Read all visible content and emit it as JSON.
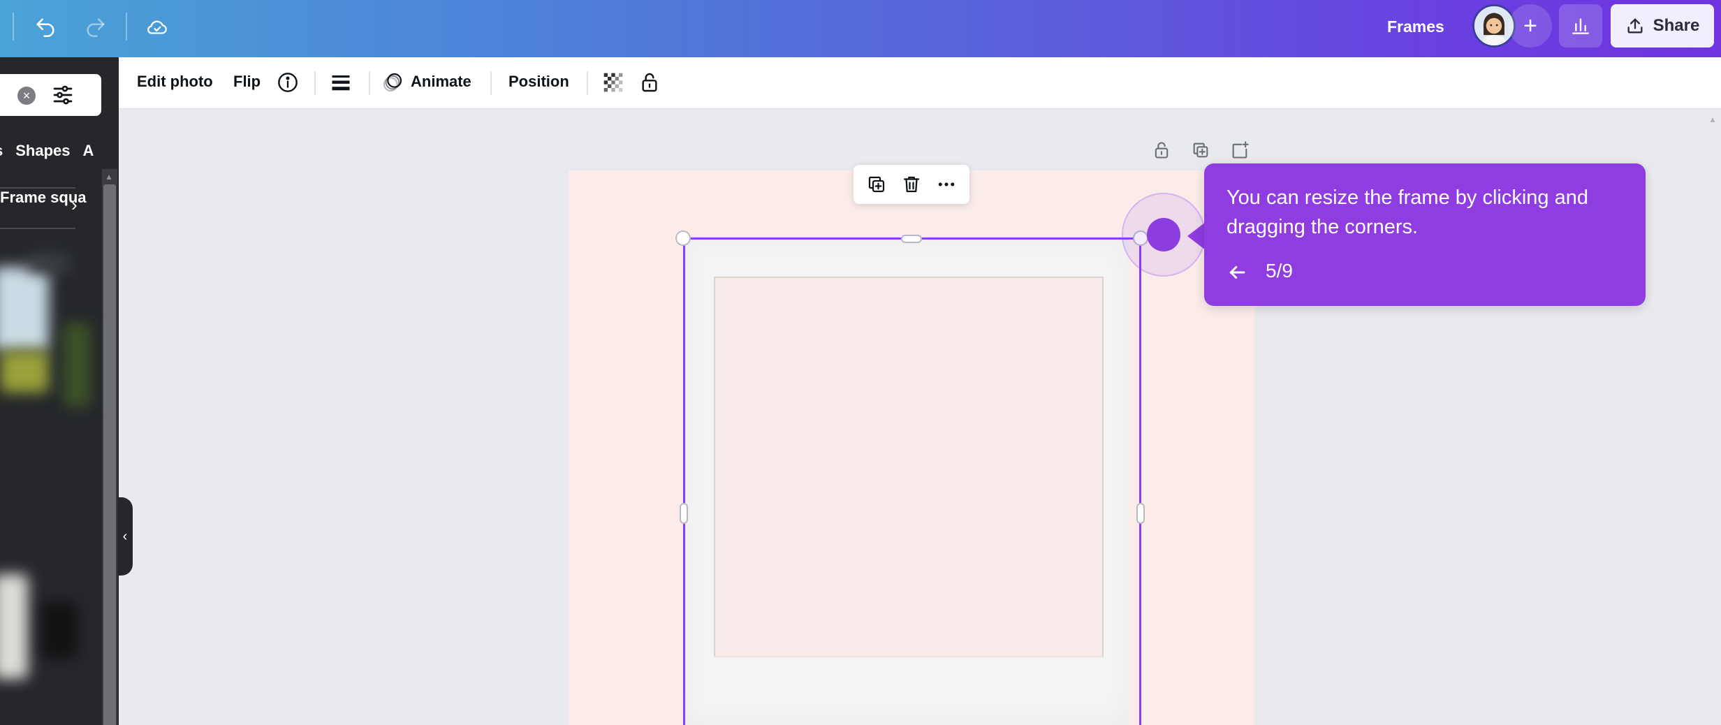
{
  "topbar": {
    "frames_label": "Frames",
    "share_label": "Share",
    "add_collaborator": "+"
  },
  "left_panel": {
    "search_clear": "×",
    "tabs": [
      "s",
      "Shapes",
      "A"
    ],
    "category_row": "Frame squa"
  },
  "context_toolbar": {
    "edit_photo": "Edit photo",
    "flip": "Flip",
    "animate": "Animate",
    "position": "Position"
  },
  "tooltip": {
    "message": "You can resize the frame by clicking and dragging the corners.",
    "step": "5/9"
  },
  "colors": {
    "accent": "#8b3dff",
    "tooltip_bg": "#8f3ce0",
    "page_bg": "#fbecea"
  }
}
